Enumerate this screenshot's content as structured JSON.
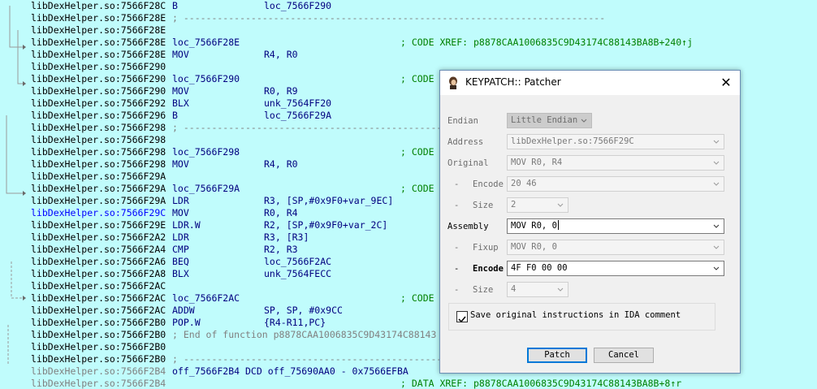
{
  "listing": [
    {
      "addr": "libDexHelper.so:7566F28C",
      "mnem": "B",
      "ops": "loc_7566F290"
    },
    {
      "addr": "libDexHelper.so:7566F28E",
      "sep": "; ---------------------------------------------------------------------------"
    },
    {
      "addr": "libDexHelper.so:7566F28E"
    },
    {
      "addr": "libDexHelper.so:7566F28E",
      "label": "loc_7566F28E",
      "cmt": "; CODE XREF: p8878CAA1006835C9D43174C88143BA8B+240↑j"
    },
    {
      "addr": "libDexHelper.so:7566F28E",
      "mnem": "MOV",
      "ops": "R4, R0"
    },
    {
      "addr": "libDexHelper.so:7566F290"
    },
    {
      "addr": "libDexHelper.so:7566F290",
      "label": "loc_7566F290",
      "cmt": "; CODE"
    },
    {
      "addr": "libDexHelper.so:7566F290",
      "mnem": "MOV",
      "ops": "R0, R9"
    },
    {
      "addr": "libDexHelper.so:7566F292",
      "mnem": "BLX",
      "ops": "unk_7564FF20"
    },
    {
      "addr": "libDexHelper.so:7566F296",
      "mnem": "B",
      "ops": "loc_7566F29A"
    },
    {
      "addr": "libDexHelper.so:7566F298",
      "sep": "; ---------------------------------------------------------------------------"
    },
    {
      "addr": "libDexHelper.so:7566F298"
    },
    {
      "addr": "libDexHelper.so:7566F298",
      "label": "loc_7566F298",
      "cmt": "; CODE"
    },
    {
      "addr": "libDexHelper.so:7566F298",
      "mnem": "MOV",
      "ops": "R4, R0"
    },
    {
      "addr": "libDexHelper.so:7566F29A"
    },
    {
      "addr": "libDexHelper.so:7566F29A",
      "label": "loc_7566F29A",
      "cmt": "; CODE"
    },
    {
      "addr": "libDexHelper.so:7566F29A",
      "mnem": "LDR",
      "ops": "R3, [SP,#0x9F0+var_9EC]"
    },
    {
      "addr": "libDexHelper.so:7566F29C",
      "mnem": "MOV",
      "ops": "R0, R4",
      "sel": true
    },
    {
      "addr": "libDexHelper.so:7566F29E",
      "mnem": "LDR.W",
      "ops": "R2, [SP,#0x9F0+var_2C]"
    },
    {
      "addr": "libDexHelper.so:7566F2A2",
      "mnem": "LDR",
      "ops": "R3, [R3]"
    },
    {
      "addr": "libDexHelper.so:7566F2A4",
      "mnem": "CMP",
      "ops": "R2, R3"
    },
    {
      "addr": "libDexHelper.so:7566F2A6",
      "mnem": "BEQ",
      "ops": "loc_7566F2AC"
    },
    {
      "addr": "libDexHelper.so:7566F2A8",
      "mnem": "BLX",
      "ops": "unk_7564FECC"
    },
    {
      "addr": "libDexHelper.so:7566F2AC"
    },
    {
      "addr": "libDexHelper.so:7566F2AC",
      "label": "loc_7566F2AC",
      "cmt": "; CODE"
    },
    {
      "addr": "libDexHelper.so:7566F2AC",
      "mnem": "ADDW",
      "ops": "SP, SP, #0x9CC"
    },
    {
      "addr": "libDexHelper.so:7566F2B0",
      "mnem": "POP.W",
      "ops": "{R4-R11,PC}"
    },
    {
      "addr": "libDexHelper.so:7566F2B0",
      "endf": "; End of function p8878CAA1006835C9D43174C88143"
    },
    {
      "addr": "libDexHelper.so:7566F2B0"
    },
    {
      "addr": "libDexHelper.so:7566F2B0",
      "sep": "; ---------------------------------------------------------------------------"
    },
    {
      "addr": "libDexHelper.so:7566F2B4",
      "dcd": "off_7566F2B4 DCD off_75690AA0 - 0x7566EFBA",
      "grey": true
    },
    {
      "addr": "libDexHelper.so:7566F2B4",
      "cmt": "; DATA XREF: p8878CAA1006835C9D43174C88143BA8B+8↑r",
      "grey": true
    }
  ],
  "dialog": {
    "title": "KEYPATCH:: Patcher",
    "endian_label": "Endian",
    "endian_value": "Little Endian",
    "address_label": "Address",
    "address_value": "libDexHelper.so:7566F29C",
    "original_label": "Original",
    "original_value": "MOV R0, R4",
    "encode_label": "Encode",
    "encode_value": "20 46",
    "size_label": "Size",
    "size_value": "2",
    "assembly_label": "Assembly",
    "assembly_value": "MOV R0, 0",
    "fixup_label": "Fixup",
    "fixup_value": "MOV R0, 0",
    "encode2_label": "Encode",
    "encode2_value": "4F F0 00 00",
    "size2_label": "Size",
    "size2_value": "4",
    "dash": "-",
    "checkbox_label": "Save original instructions in IDA comment",
    "checkbox_checked": true,
    "patch_label": "Patch",
    "cancel_label": "Cancel"
  },
  "colors": {
    "background": "#c0fcfc",
    "code": "#000080",
    "comment": "#008000",
    "selected_address": "#0000ff",
    "separator": "#808080"
  }
}
